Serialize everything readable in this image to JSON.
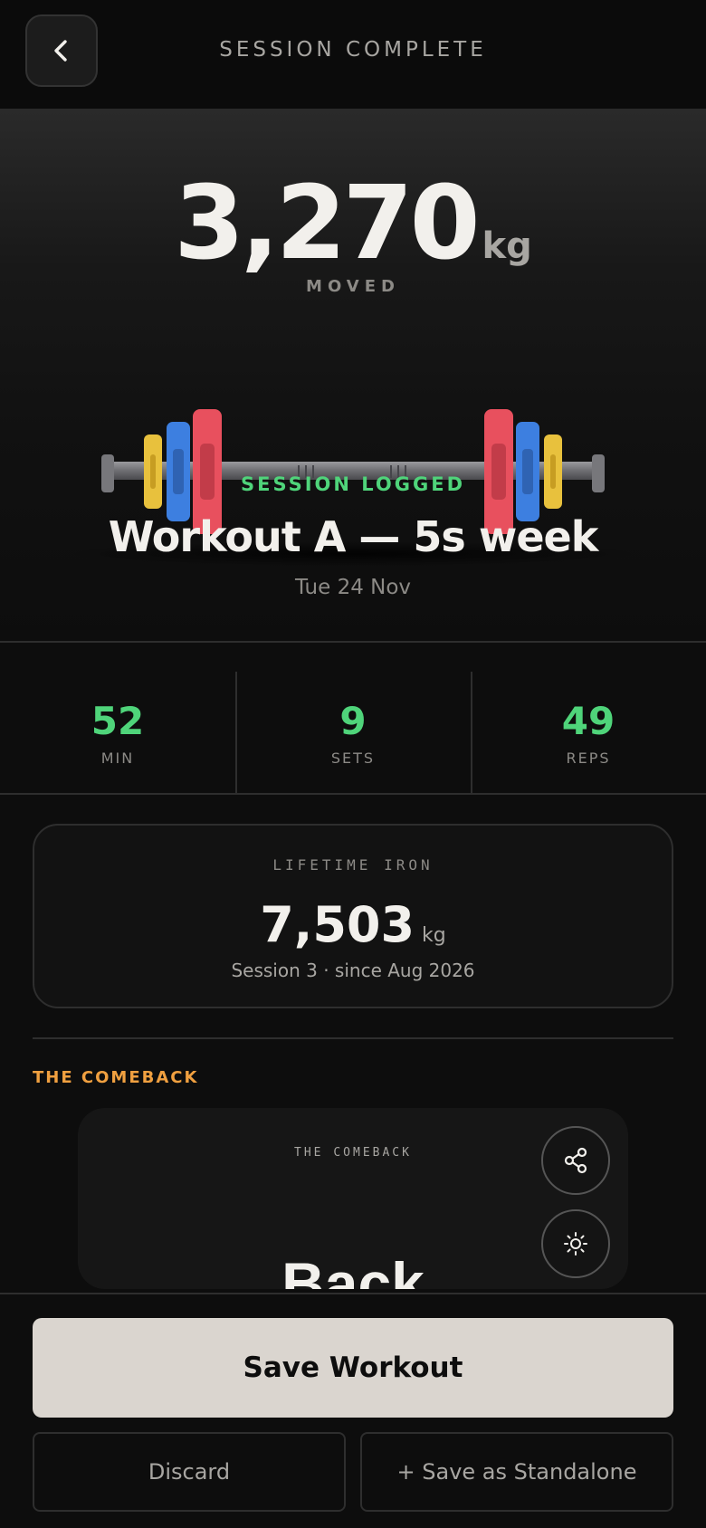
{
  "header": {
    "title": "SESSION COMPLETE",
    "back_icon": "chevron-left-icon"
  },
  "hero": {
    "total_value": "3,270",
    "total_unit": "kg",
    "total_label": "MOVED",
    "status": "SESSION LOGGED",
    "workout_title": "Workout A — 5s week",
    "date": "Tue 24 Nov",
    "plate_colors": {
      "red": "#e8505e",
      "blue": "#3d7fe0",
      "yellow": "#e8c13d"
    }
  },
  "stats": [
    {
      "value": "52",
      "label": "MIN"
    },
    {
      "value": "9",
      "label": "SETS"
    },
    {
      "value": "49",
      "label": "REPS"
    }
  ],
  "lifetime": {
    "label": "LIFETIME IRON",
    "value": "7,503",
    "unit": "kg",
    "subtitle": "Session 3 · since Aug 2026"
  },
  "comeback": {
    "section_label": "THE COMEBACK",
    "card_tag": "THE COMEBACK",
    "headline": "Back",
    "share_icon": "share-icon",
    "theme_icon": "sun-icon"
  },
  "actions": {
    "save": "Save Workout",
    "discard": "Discard",
    "standalone": "+ Save as Standalone"
  },
  "colors": {
    "accent_green": "#4fd47a",
    "accent_orange": "#f0a040",
    "save_button": "#dad5cf"
  }
}
